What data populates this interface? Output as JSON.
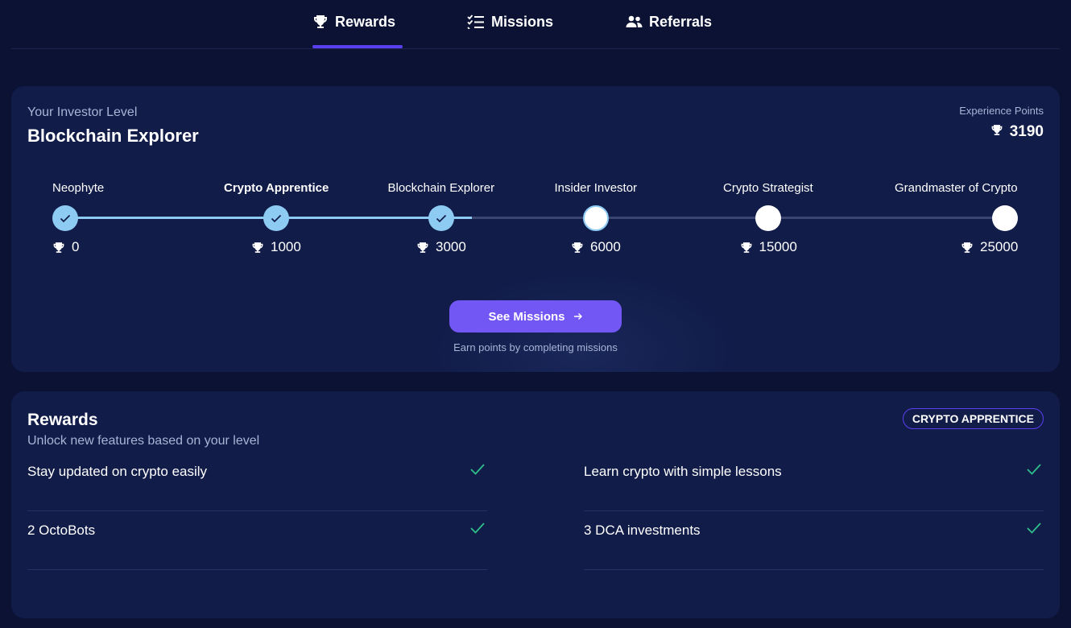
{
  "tabs": [
    {
      "label": "Rewards",
      "icon": "trophy-icon",
      "active": true
    },
    {
      "label": "Missions",
      "icon": "checklist-icon",
      "active": false
    },
    {
      "label": "Referrals",
      "icon": "users-icon",
      "active": false
    }
  ],
  "level": {
    "label": "Your Investor Level",
    "name": "Blockchain Explorer",
    "xp_label": "Experience Points",
    "xp_value": "3190",
    "progress_fraction": 0.4328
  },
  "milestones": [
    {
      "name": "Neophyte",
      "points": "0",
      "state": "done",
      "bold": false
    },
    {
      "name": "Crypto Apprentice",
      "points": "1000",
      "state": "done",
      "bold": true
    },
    {
      "name": "Blockchain Explorer",
      "points": "3000",
      "state": "done",
      "bold": false
    },
    {
      "name": "Insider Investor",
      "points": "6000",
      "state": "next",
      "bold": false
    },
    {
      "name": "Crypto Strategist",
      "points": "15000",
      "state": "future",
      "bold": false
    },
    {
      "name": "Grandmaster of Crypto",
      "points": "25000",
      "state": "future",
      "bold": false
    }
  ],
  "cta": {
    "label": "See Missions",
    "hint": "Earn points by completing missions"
  },
  "rewards": {
    "title": "Rewards",
    "subtitle": "Unlock new features based on your level",
    "badge": "CRYPTO APPRENTICE",
    "items": [
      {
        "text": "Stay updated on crypto easily",
        "unlocked": true
      },
      {
        "text": "Learn crypto with simple lessons",
        "unlocked": true
      },
      {
        "text": "2 OctoBots",
        "unlocked": true
      },
      {
        "text": "3 DCA investments",
        "unlocked": true
      }
    ]
  },
  "colors": {
    "background": "#0b1233",
    "card": "#111c49",
    "accent": "#7357f5",
    "progress": "#8ecbf3",
    "check": "#2fbf8a"
  }
}
